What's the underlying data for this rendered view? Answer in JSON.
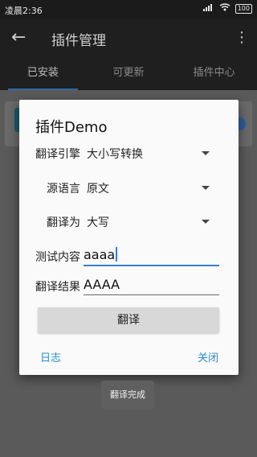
{
  "status_bar": {
    "time": "凌晨2:36",
    "signal_icon": "signal-bars-icon",
    "wifi_icon": "wifi-icon",
    "battery": "100"
  },
  "app_bar": {
    "title": "插件管理",
    "back_icon": "arrow-left-icon",
    "more_icon": "more-vert-icon"
  },
  "tabs": [
    {
      "label": "已安装",
      "active": true
    },
    {
      "label": "可更新",
      "active": false
    },
    {
      "label": "插件中心",
      "active": false
    }
  ],
  "dialog": {
    "title": "插件Demo",
    "engine_label": "翻译引擎",
    "engine_value": "大小写转换",
    "source_label": "源语言",
    "source_value": "原文",
    "target_label": "翻译为",
    "target_value": "大写",
    "test_label": "测试内容",
    "test_value": "aaaa",
    "result_label": "翻译结果",
    "result_value": "AAAA",
    "translate_button": "翻译",
    "log_button": "日志",
    "close_button": "关闭"
  },
  "toast": "翻译完成",
  "colors": {
    "accent": "#2f6aa6",
    "link": "#2b8ccf",
    "focus": "#3b7ed6"
  }
}
